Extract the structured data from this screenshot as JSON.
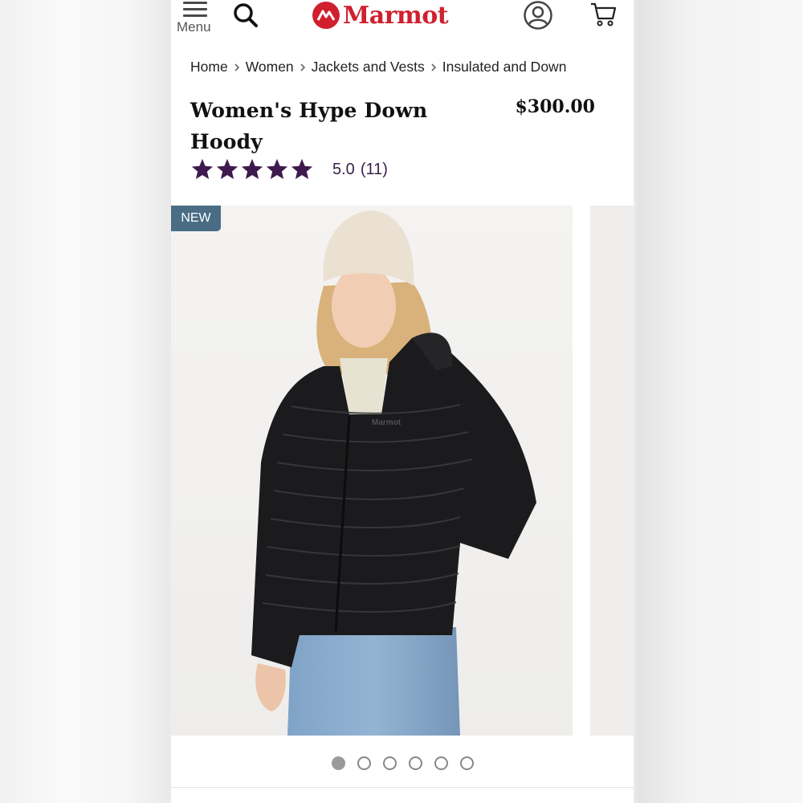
{
  "header": {
    "menu_label": "Menu",
    "logo_text": "Marmot",
    "brand_color": "#d0202e",
    "icons": [
      "menu-icon",
      "search-icon",
      "marmot-logo-icon",
      "account-icon",
      "cart-icon"
    ]
  },
  "breadcrumb": {
    "items": [
      "Home",
      "Women",
      "Jackets and Vests",
      "Insulated and Down"
    ]
  },
  "product": {
    "title": "Women's Hype Down Hoody",
    "price": "$300.00",
    "rating_value": "5.0",
    "rating_count": "(11)",
    "stars": 5,
    "star_color": "#3f1a4e",
    "badge": "NEW",
    "badge_color": "#4a6d85",
    "image_text": "Marmot"
  },
  "gallery": {
    "total_images": 6,
    "active_index": 0
  }
}
